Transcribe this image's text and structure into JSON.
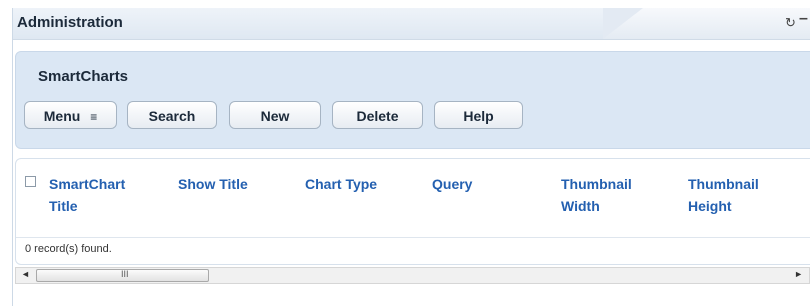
{
  "portlet": {
    "title": "Administration",
    "controls": {
      "refresh_icon": "refresh-icon",
      "minimize_icon": "minimize-icon",
      "maximize_icon": "maximize-icon"
    }
  },
  "panel": {
    "title": "SmartCharts",
    "buttons": {
      "menu": "Menu",
      "menu_arrow": "≡",
      "search": "Search",
      "new": "New",
      "delete": "Delete",
      "help": "Help"
    }
  },
  "grid": {
    "columns": [
      [
        "SmartChart",
        "Title"
      ],
      [
        "Show Title"
      ],
      [
        "Chart Type"
      ],
      [
        "Query"
      ],
      [
        "Thumbnail",
        "Width"
      ],
      [
        "Thumbnail",
        "Height"
      ]
    ],
    "records_text": "0 record(s) found."
  },
  "scrollbar": {
    "left_arrow": "◄",
    "right_arrow": "►",
    "grip": "III"
  }
}
